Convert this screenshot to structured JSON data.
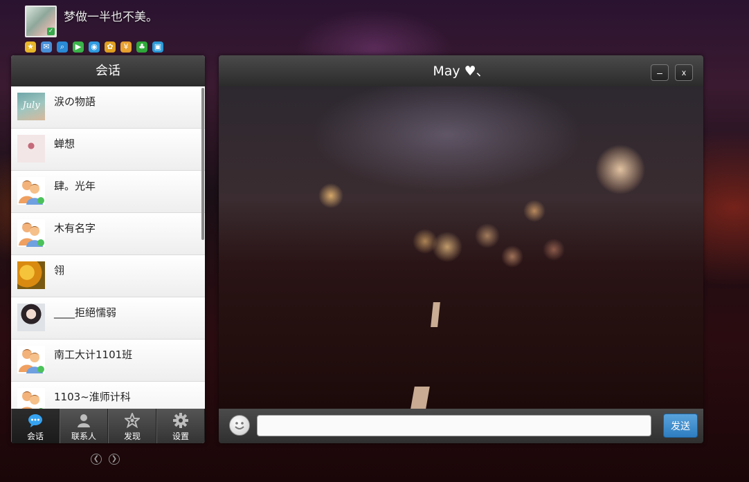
{
  "profile": {
    "nickname": "梦做一半也不美。",
    "shortcuts": [
      {
        "icon": "star-icon",
        "glyph": "★",
        "color": "#e8b82a"
      },
      {
        "icon": "mail-icon",
        "glyph": "✉",
        "color": "#4a90d9"
      },
      {
        "icon": "search-icon",
        "glyph": "⌕",
        "color": "#2a8ad6"
      },
      {
        "icon": "app-store-icon",
        "glyph": "▶",
        "color": "#3bb34a"
      },
      {
        "icon": "browser-icon",
        "glyph": "◉",
        "color": "#2f9be0"
      },
      {
        "icon": "game-icon",
        "glyph": "✿",
        "color": "#e0a020"
      },
      {
        "icon": "wallet-icon",
        "glyph": "¥",
        "color": "#e8a030"
      },
      {
        "icon": "clover-icon",
        "glyph": "♣",
        "color": "#2fa83a"
      },
      {
        "icon": "photo-icon",
        "glyph": "▣",
        "color": "#2a9ad8"
      }
    ]
  },
  "sidebar": {
    "title": "会话",
    "conversations": [
      {
        "name": "涙の物語",
        "avatar": "july"
      },
      {
        "name": "蝉想",
        "avatar": "flower"
      },
      {
        "name": "肆。光年",
        "avatar": "buddy"
      },
      {
        "name": "木有名字",
        "avatar": "buddy"
      },
      {
        "name": "翎",
        "avatar": "sun"
      },
      {
        "name": "____拒絕懦弱",
        "avatar": "girl"
      },
      {
        "name": "南工大计1101班",
        "avatar": "buddy"
      },
      {
        "name": "1103~淮师计科",
        "avatar": "buddy"
      }
    ],
    "july_text": "July",
    "tabs": [
      {
        "label": "会话",
        "icon": "chat-bubble-icon",
        "active": true
      },
      {
        "label": "联系人",
        "icon": "contacts-icon",
        "active": false
      },
      {
        "label": "发现",
        "icon": "discover-star-icon",
        "active": false
      },
      {
        "label": "设置",
        "icon": "settings-gear-icon",
        "active": false
      }
    ]
  },
  "chat": {
    "title": "May ♥、",
    "minimize_label": "–",
    "close_label": "x",
    "input_value": "",
    "input_placeholder": "",
    "send_label": "发送"
  },
  "colors": {
    "accent": "#36a3f0",
    "send_button": "#2e7dc0"
  }
}
